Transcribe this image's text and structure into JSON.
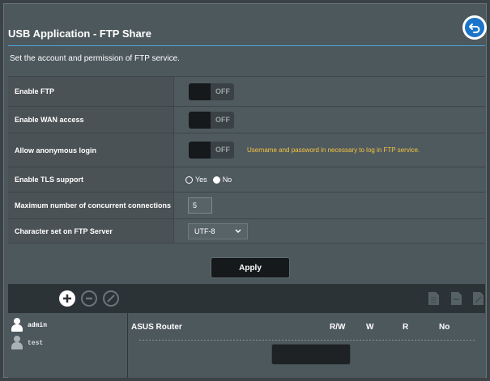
{
  "header": {
    "title": "USB Application - FTP Share",
    "description": "Set the account and permission of FTP service."
  },
  "settings": {
    "enable_ftp": {
      "label": "Enable FTP",
      "state": "OFF"
    },
    "enable_wan": {
      "label": "Enable WAN access",
      "state": "OFF"
    },
    "anonymous": {
      "label": "Allow anonymous login",
      "state": "OFF",
      "hint": "Username and password in necessary to log in FTP service."
    },
    "tls": {
      "label": "Enable TLS support",
      "yes": "Yes",
      "no": "No",
      "selected": "No"
    },
    "max_conn": {
      "label": "Maximum number of concurrent connections",
      "value": "5"
    },
    "charset": {
      "label": "Character set on FTP Server",
      "value": "UTF-8"
    }
  },
  "apply": {
    "label": "Apply"
  },
  "users": [
    {
      "name": "admin"
    },
    {
      "name": "test"
    }
  ],
  "permissions": {
    "device": "ASUS Router",
    "columns": [
      "R/W",
      "W",
      "R",
      "No"
    ]
  },
  "colors": {
    "accent": "#4aa3d9",
    "hint": "#f6c343",
    "back_button": "#1a74c9"
  },
  "icons": {
    "back": "back-arrow-icon",
    "add": "add-user-icon",
    "remove": "remove-user-icon",
    "edit": "edit-user-icon"
  }
}
